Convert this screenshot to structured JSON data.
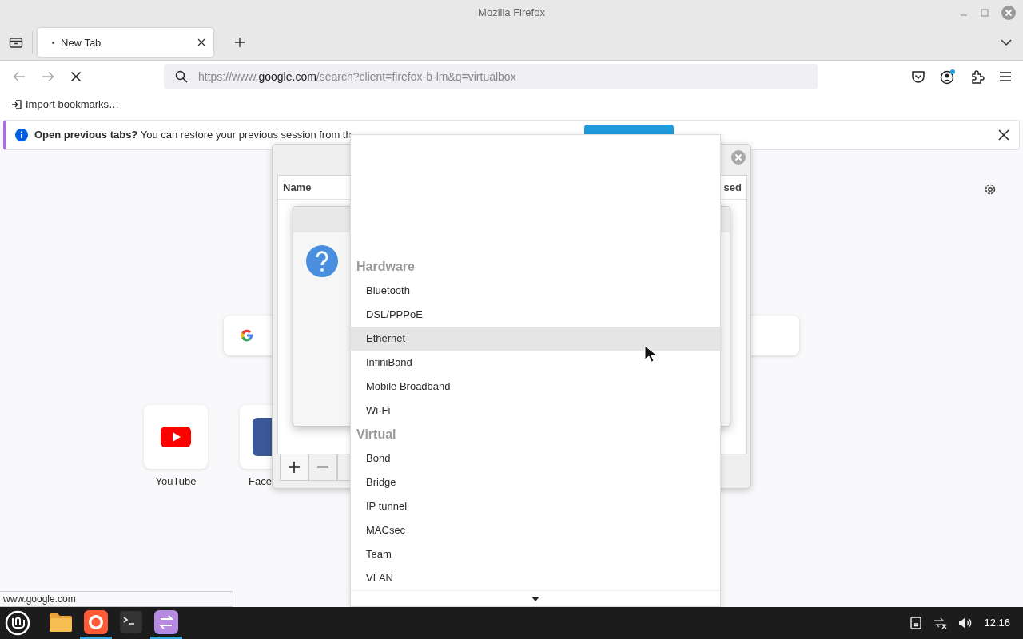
{
  "window": {
    "title": "Mozilla Firefox"
  },
  "tabs": [
    {
      "label": "New Tab",
      "selected": true
    }
  ],
  "address_bar": {
    "scheme": "https://www.",
    "domain": "google.com",
    "path": "/search?client=firefox-b-lm&q=virtualbox"
  },
  "bookmarks": [
    {
      "label": "Import bookmarks…"
    }
  ],
  "infobar": {
    "title": "Open previous tabs?",
    "message": "You can restore your previous session from th"
  },
  "shortcuts": [
    {
      "kind": "youtube",
      "label": "YouTube"
    },
    {
      "kind": "facebook",
      "label": "Face"
    }
  ],
  "connections_window": {
    "columns": [
      "Name",
      "sed"
    ]
  },
  "type_menu": {
    "groups": [
      {
        "heading": "Hardware",
        "items": [
          {
            "label": "Bluetooth",
            "selected": false
          },
          {
            "label": "DSL/PPPoE",
            "selected": false
          },
          {
            "label": "Ethernet",
            "selected": true
          },
          {
            "label": "InfiniBand",
            "selected": false
          },
          {
            "label": "Mobile Broadband",
            "selected": false
          },
          {
            "label": "Wi-Fi",
            "selected": false
          }
        ]
      },
      {
        "heading": "Virtual",
        "items": [
          {
            "label": "Bond",
            "selected": false
          },
          {
            "label": "Bridge",
            "selected": false
          },
          {
            "label": "IP tunnel",
            "selected": false
          },
          {
            "label": "MACsec",
            "selected": false
          },
          {
            "label": "Team",
            "selected": false
          },
          {
            "label": "VLAN",
            "selected": false
          }
        ]
      }
    ]
  },
  "status_text": "www.google.com",
  "taskbar": {
    "apps": [
      {
        "kind": "files",
        "running": false
      },
      {
        "kind": "firefox",
        "running": true
      },
      {
        "kind": "terminal",
        "running": false
      },
      {
        "kind": "network",
        "running": true
      }
    ],
    "clock": "12:16"
  }
}
